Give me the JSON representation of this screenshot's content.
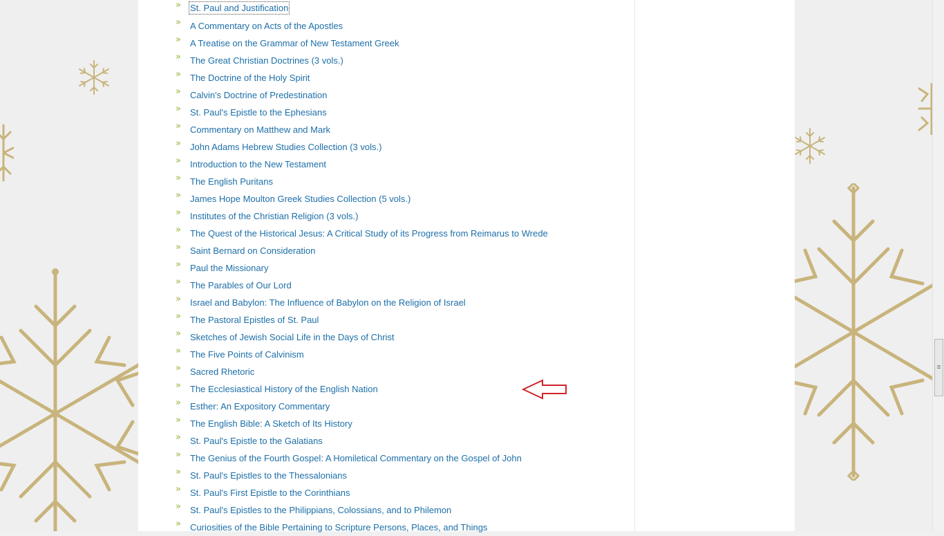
{
  "colors": {
    "link": "#1d6fa8",
    "bullet": "#9ab23a",
    "snowflake": "#c8b47c",
    "annotation_arrow": "#d0232b"
  },
  "icons": {
    "bullet": "double-chevron-right-icon",
    "annotation": "red-arrow-left-icon",
    "background": "snowflake-icon"
  },
  "bullet_glyph": "»",
  "books": [
    {
      "title": "St. Paul and Justification"
    },
    {
      "title": "A Commentary on Acts of the Apostles"
    },
    {
      "title": "A Treatise on the Grammar of New Testament Greek"
    },
    {
      "title": "The Great Christian Doctrines (3 vols.)"
    },
    {
      "title": "The Doctrine of the Holy Spirit"
    },
    {
      "title": "Calvin's Doctrine of Predestination"
    },
    {
      "title": "St. Paul's Epistle to the Ephesians"
    },
    {
      "title": "Commentary on Matthew and Mark"
    },
    {
      "title": "John Adams Hebrew Studies Collection (3 vols.)"
    },
    {
      "title": "Introduction to the New Testament"
    },
    {
      "title": "The English Puritans"
    },
    {
      "title": "James Hope Moulton Greek Studies Collection (5 vols.)"
    },
    {
      "title": "Institutes of the Christian Religion (3 vols.)"
    },
    {
      "title": "The Quest of the Historical Jesus: A Critical Study of its Progress from Reimarus to Wrede"
    },
    {
      "title": "Saint Bernard on Consideration"
    },
    {
      "title": "Paul the Missionary"
    },
    {
      "title": "The Parables of Our Lord"
    },
    {
      "title": "Israel and Babylon: The Influence of Babylon on the Religion of Israel"
    },
    {
      "title": "The Pastoral Epistles of St. Paul"
    },
    {
      "title": "Sketches of Jewish Social Life in the Days of Christ"
    },
    {
      "title": "The Five Points of Calvinism"
    },
    {
      "title": "Sacred Rhetoric"
    },
    {
      "title": "The Ecclesiastical History of the English Nation"
    },
    {
      "title": "Esther: An Expository Commentary"
    },
    {
      "title": "The English Bible: A Sketch of Its History"
    },
    {
      "title": "St. Paul's Epistle to the Galatians"
    },
    {
      "title": "The Genius of the Fourth Gospel: A Homiletical Commentary on the Gospel of John"
    },
    {
      "title": "St. Paul's Epistles to the Thessalonians"
    },
    {
      "title": "St. Paul's First Epistle to the Corinthians"
    },
    {
      "title": "St. Paul's Epistles to the Philippians, Colossians, and to Philemon"
    },
    {
      "title": "Curiosities of the Bible Pertaining to Scripture Persons, Places, and Things"
    }
  ]
}
